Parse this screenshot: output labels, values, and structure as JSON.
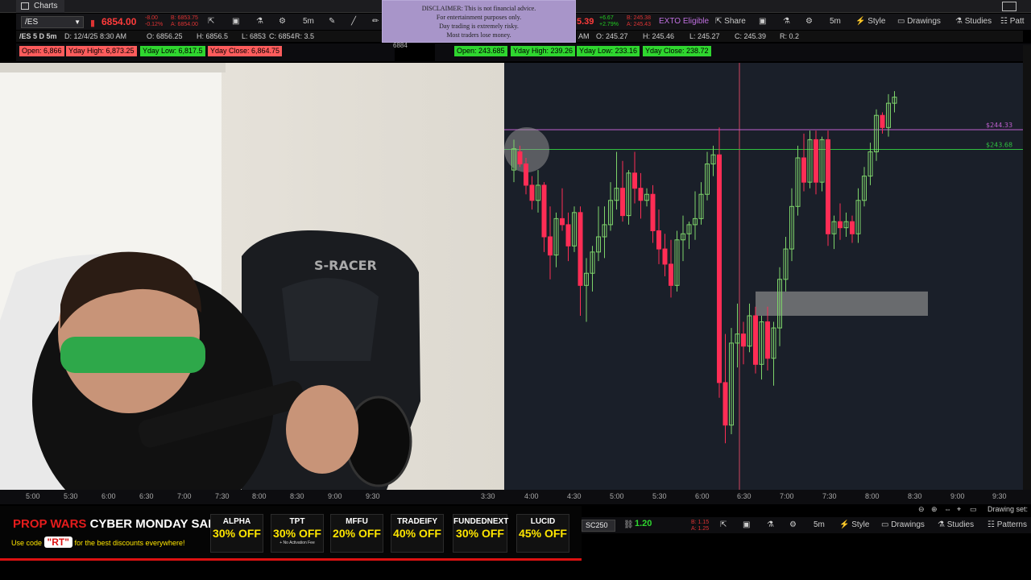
{
  "app": {
    "tab_label": "Charts"
  },
  "left_toolbar": {
    "symbol": "/ES",
    "price": "6854.00",
    "price_sub1": "-8.00",
    "price_sub2": "-0.12%",
    "bid": "B: 6853.75",
    "ask": "A: 6854.00",
    "timeframe": "5m",
    "info_line": {
      "title": "/ES 5 D 5m",
      "date": "D: 12/4/25 8:30 AM",
      "open": "O: 6856.25",
      "high": "H: 6856.5",
      "low": "L: 6853",
      "close": "C: 6854",
      "range": "R: 3.5"
    },
    "badges": [
      "Open: 6,866",
      "Yday High: 6,873.25",
      "Yday Low: 6,817.5",
      "Yday Close: 6,864.75"
    ],
    "scale_label": "6884"
  },
  "right_toolbar": {
    "price_partial": "5.39",
    "change": "+6.67",
    "change_pct": "+2.79%",
    "bid": "B: 245.38",
    "ask": "A: 245.43",
    "exto": "EXTO Eligible",
    "share": "Share",
    "timeframe": "5m",
    "style": "Style",
    "drawings": "Drawings",
    "studies": "Studies",
    "patterns": "Patt",
    "info_line": {
      "date": "AM",
      "open": "O: 245.27",
      "high": "H: 245.46",
      "low": "L: 245.27",
      "close": "C: 245.39",
      "range": "R: 0.2"
    },
    "badges": [
      "Open: 243.685",
      "Yday High: 239.26",
      "Yday Low: 233.16",
      "Yday Close: 238.72"
    ],
    "levels": [
      {
        "label": "$244.33",
        "price": 244.33,
        "color": "#c060d0"
      },
      {
        "label": "$243.68",
        "price": 243.68,
        "color": "#30c040"
      }
    ]
  },
  "disclaimer": {
    "lines": [
      "DISCLAIMER: This is not financial advice.",
      "For entertainment purposes only.",
      "Day trading is extremely risky.",
      "Most traders lose money."
    ]
  },
  "xaxis": {
    "left": [
      "5:00",
      "5:30",
      "6:00",
      "6:30",
      "7:00",
      "7:30",
      "8:00",
      "8:30",
      "9:00",
      "9:30"
    ],
    "right": [
      "3:30",
      "4:00",
      "4:30",
      "5:00",
      "5:30",
      "6:00",
      "6:30",
      "7:00",
      "7:30",
      "8:00",
      "8:30",
      "9:00",
      "9:30"
    ]
  },
  "bottom_toolbar": {
    "symbol": "SC250",
    "price": "1.20",
    "bid": "B: 1.15",
    "ask": "A: 1.25",
    "timeframe": "5m",
    "style": "Style",
    "drawings": "Drawings",
    "studies": "Studies",
    "patterns": "Patterns",
    "drawing_set": "Drawing set:"
  },
  "banner": {
    "brand1": "PROP WARS",
    "brand2": "CYBER MONDAY SALES!",
    "code_prefix": "Use code",
    "code": "\"RT\"",
    "code_suffix": "for the best discounts everywhere!",
    "offers": [
      {
        "firm": "ALPHA",
        "discount": "30% OFF",
        "note": ""
      },
      {
        "firm": "TPT",
        "discount": "30% OFF",
        "note": "+ No Activation Fee"
      },
      {
        "firm": "MFFU",
        "discount": "20% OFF",
        "note": ""
      },
      {
        "firm": "TRADEIFY",
        "discount": "40% OFF",
        "note": ""
      },
      {
        "firm": "FUNDEDNEXT",
        "discount": "30% OFF",
        "note": ""
      },
      {
        "firm": "LUCID",
        "discount": "45% OFF",
        "note": ""
      }
    ]
  },
  "chair_brand": "S-RACER",
  "colors": {
    "up": "#7dd36a",
    "down": "#ff2d55",
    "accent_red": "#d11",
    "promo_yellow": "#ffe600"
  },
  "chart_data": {
    "type": "candlestick",
    "ylim": [
      233.0,
      246.0
    ],
    "levels": [
      244.33,
      243.68
    ],
    "candles": [
      {
        "o": 243.0,
        "h": 244.0,
        "l": 242.6,
        "c": 243.7
      },
      {
        "o": 243.6,
        "h": 243.8,
        "l": 243.1,
        "c": 243.2
      },
      {
        "o": 243.2,
        "h": 243.4,
        "l": 242.2,
        "c": 242.5
      },
      {
        "o": 242.5,
        "h": 242.8,
        "l": 241.7,
        "c": 242.0
      },
      {
        "o": 242.0,
        "h": 243.0,
        "l": 241.6,
        "c": 242.5
      },
      {
        "o": 242.5,
        "h": 242.6,
        "l": 240.3,
        "c": 240.8
      },
      {
        "o": 240.8,
        "h": 241.8,
        "l": 239.4,
        "c": 240.2
      },
      {
        "o": 240.2,
        "h": 241.6,
        "l": 239.8,
        "c": 241.4
      },
      {
        "o": 241.4,
        "h": 242.4,
        "l": 241.0,
        "c": 241.2
      },
      {
        "o": 241.2,
        "h": 241.6,
        "l": 240.0,
        "c": 240.5
      },
      {
        "o": 240.5,
        "h": 241.8,
        "l": 240.3,
        "c": 241.6
      },
      {
        "o": 241.6,
        "h": 241.8,
        "l": 238.2,
        "c": 239.2
      },
      {
        "o": 239.2,
        "h": 240.1,
        "l": 238.0,
        "c": 239.6
      },
      {
        "o": 239.6,
        "h": 240.5,
        "l": 239.0,
        "c": 240.3
      },
      {
        "o": 240.3,
        "h": 241.8,
        "l": 240.0,
        "c": 240.8
      },
      {
        "o": 240.8,
        "h": 241.8,
        "l": 240.1,
        "c": 241.2
      },
      {
        "o": 241.2,
        "h": 242.6,
        "l": 241.0,
        "c": 242.0
      },
      {
        "o": 242.0,
        "h": 243.6,
        "l": 241.7,
        "c": 242.4
      },
      {
        "o": 242.4,
        "h": 243.3,
        "l": 241.3,
        "c": 241.5
      },
      {
        "o": 241.5,
        "h": 243.0,
        "l": 241.2,
        "c": 242.9
      },
      {
        "o": 242.9,
        "h": 243.6,
        "l": 241.9,
        "c": 242.4
      },
      {
        "o": 242.4,
        "h": 242.9,
        "l": 241.4,
        "c": 242.0
      },
      {
        "o": 242.0,
        "h": 242.4,
        "l": 241.8,
        "c": 242.2
      },
      {
        "o": 242.2,
        "h": 242.5,
        "l": 240.6,
        "c": 241.0
      },
      {
        "o": 241.0,
        "h": 241.7,
        "l": 239.9,
        "c": 240.4
      },
      {
        "o": 240.4,
        "h": 240.9,
        "l": 239.5,
        "c": 239.9
      },
      {
        "o": 239.9,
        "h": 240.7,
        "l": 238.8,
        "c": 239.2
      },
      {
        "o": 239.2,
        "h": 241.0,
        "l": 239.0,
        "c": 240.7
      },
      {
        "o": 240.7,
        "h": 241.5,
        "l": 240.0,
        "c": 240.9
      },
      {
        "o": 240.9,
        "h": 241.3,
        "l": 240.4,
        "c": 241.2
      },
      {
        "o": 241.2,
        "h": 242.3,
        "l": 240.7,
        "c": 241.4
      },
      {
        "o": 241.4,
        "h": 242.6,
        "l": 241.2,
        "c": 242.2
      },
      {
        "o": 242.2,
        "h": 243.6,
        "l": 242.0,
        "c": 243.2
      },
      {
        "o": 243.2,
        "h": 243.8,
        "l": 242.8,
        "c": 243.5
      },
      {
        "o": 243.5,
        "h": 244.4,
        "l": 235.5,
        "c": 236.0
      },
      {
        "o": 236.0,
        "h": 237.6,
        "l": 234.0,
        "c": 234.6
      },
      {
        "o": 234.6,
        "h": 237.8,
        "l": 234.3,
        "c": 237.3
      },
      {
        "o": 237.3,
        "h": 238.6,
        "l": 236.5,
        "c": 237.6
      },
      {
        "o": 237.6,
        "h": 238.0,
        "l": 236.6,
        "c": 237.2
      },
      {
        "o": 237.2,
        "h": 238.6,
        "l": 237.0,
        "c": 238.2
      },
      {
        "o": 238.2,
        "h": 238.5,
        "l": 236.3,
        "c": 236.6
      },
      {
        "o": 236.6,
        "h": 238.2,
        "l": 236.1,
        "c": 238.0
      },
      {
        "o": 238.0,
        "h": 238.5,
        "l": 236.4,
        "c": 236.8
      },
      {
        "o": 236.8,
        "h": 238.0,
        "l": 235.9,
        "c": 237.8
      },
      {
        "o": 237.8,
        "h": 239.8,
        "l": 237.2,
        "c": 239.4
      },
      {
        "o": 239.4,
        "h": 240.8,
        "l": 239.0,
        "c": 240.4
      },
      {
        "o": 240.4,
        "h": 242.4,
        "l": 240.0,
        "c": 241.8
      },
      {
        "o": 241.8,
        "h": 243.8,
        "l": 241.5,
        "c": 243.4
      },
      {
        "o": 243.4,
        "h": 244.2,
        "l": 242.3,
        "c": 242.6
      },
      {
        "o": 242.6,
        "h": 244.3,
        "l": 242.4,
        "c": 244.0
      },
      {
        "o": 244.0,
        "h": 244.3,
        "l": 242.2,
        "c": 242.6
      },
      {
        "o": 242.6,
        "h": 244.1,
        "l": 242.3,
        "c": 244.0
      },
      {
        "o": 244.0,
        "h": 244.3,
        "l": 240.5,
        "c": 240.9
      },
      {
        "o": 240.9,
        "h": 241.5,
        "l": 240.4,
        "c": 241.3
      },
      {
        "o": 241.3,
        "h": 241.9,
        "l": 240.7,
        "c": 241.1
      },
      {
        "o": 241.1,
        "h": 241.6,
        "l": 240.8,
        "c": 241.3
      },
      {
        "o": 241.3,
        "h": 241.5,
        "l": 240.6,
        "c": 240.9
      },
      {
        "o": 240.9,
        "h": 242.4,
        "l": 240.6,
        "c": 242.0
      },
      {
        "o": 242.0,
        "h": 243.1,
        "l": 241.8,
        "c": 242.8
      },
      {
        "o": 242.8,
        "h": 243.9,
        "l": 242.5,
        "c": 243.6
      },
      {
        "o": 243.6,
        "h": 245.0,
        "l": 243.3,
        "c": 244.8
      },
      {
        "o": 244.8,
        "h": 244.9,
        "l": 244.2,
        "c": 244.4
      },
      {
        "o": 244.4,
        "h": 245.5,
        "l": 244.1,
        "c": 245.2
      },
      {
        "o": 245.2,
        "h": 245.6,
        "l": 244.9,
        "c": 245.4
      }
    ]
  }
}
